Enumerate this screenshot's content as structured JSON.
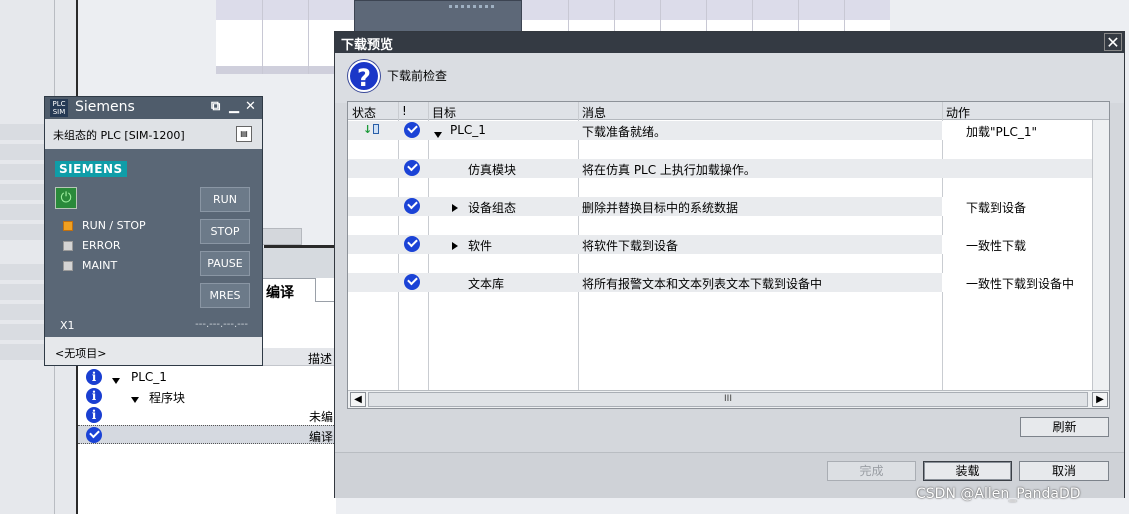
{
  "simulator": {
    "logo_text": "PLC SIM",
    "title": "Siemens",
    "status_text": "未组态的 PLC [SIM-1200]",
    "brand": "SIEMENS",
    "leds": [
      {
        "label": "RUN / STOP",
        "state": "on"
      },
      {
        "label": "ERROR",
        "state": "off"
      },
      {
        "label": "MAINT",
        "state": "off"
      }
    ],
    "buttons": [
      "RUN",
      "STOP",
      "PAUSE",
      "MRES"
    ],
    "port_label": "X1",
    "ip_text": "---.---.---.---",
    "project_text": "<无项目>"
  },
  "background_panel": {
    "tab_label": "编译",
    "column_desc": "描述",
    "rows": [
      {
        "icon": "info-icon",
        "expand": "down",
        "label": "PLC_1",
        "desc": ""
      },
      {
        "icon": "info-icon",
        "expand": "down",
        "label": "程序块",
        "desc": ""
      },
      {
        "icon": "info-icon",
        "expand": "",
        "label": "",
        "desc": "未编"
      },
      {
        "icon": "check-icon",
        "expand": "",
        "label": "",
        "desc": "编译"
      }
    ]
  },
  "dialog": {
    "title": "下载预览",
    "subtitle": "下载前检查",
    "columns": {
      "status": "状态",
      "flag": "!",
      "target": "目标",
      "message": "消息",
      "action": "动作"
    },
    "rows": [
      {
        "expand": "down",
        "target": "PLC_1",
        "message": "下载准备就绪。",
        "action": "加载\"PLC_1\"",
        "status_icon": true
      },
      {
        "expand": "",
        "target": "仿真模块",
        "message": "将在仿真 PLC 上执行加载操作。",
        "action": ""
      },
      {
        "expand": "right",
        "target": "设备组态",
        "message": "删除并替换目标中的系统数据",
        "action": "下载到设备"
      },
      {
        "expand": "right",
        "target": "软件",
        "message": "将软件下载到设备",
        "action": "一致性下载"
      },
      {
        "expand": "",
        "target": "文本库",
        "message": "将所有报警文本和文本列表文本下载到设备中",
        "action": "一致性下载到设备中"
      }
    ],
    "scroll_thumb": "III",
    "refresh_label": "刷新",
    "finish_label": "完成",
    "load_label": "装载",
    "cancel_label": "取消"
  },
  "watermark": "CSDN @Allen_PandaDD"
}
